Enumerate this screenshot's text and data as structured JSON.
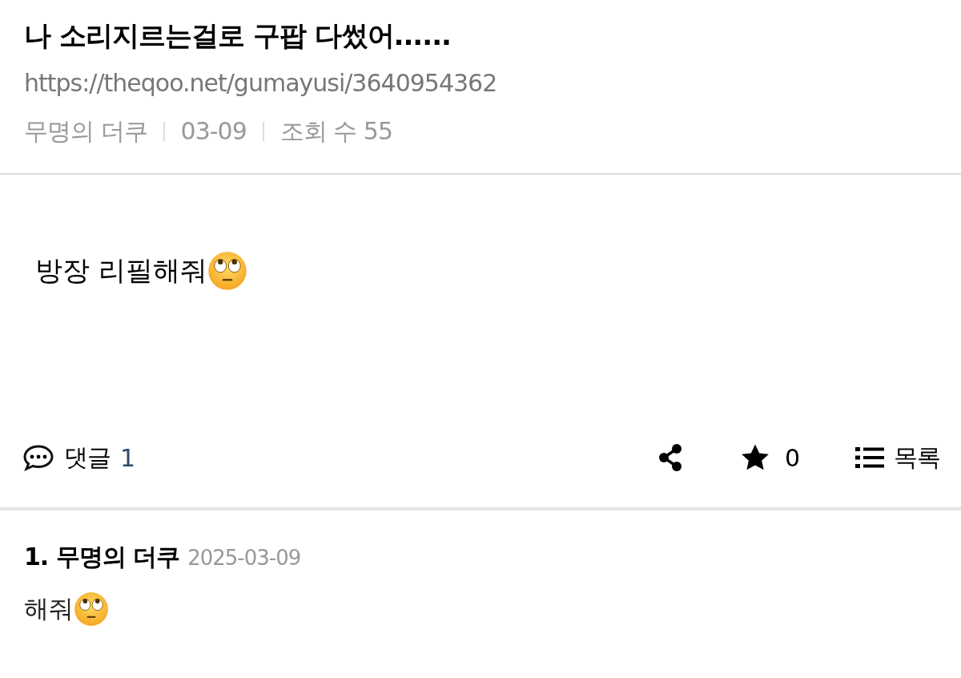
{
  "post": {
    "title": "나 소리지르는걸로 구팝 다썼어......",
    "url": "https://theqoo.net/gumayusi/3640954362",
    "meta": [
      "무명의 더쿠",
      "03-09",
      "조회 수 55"
    ],
    "body": "방장 리필해줘"
  },
  "toolbar": {
    "comments_label": "댓글",
    "comments_count": "1",
    "stars_count": "0",
    "list_label": "목록"
  },
  "comments": [
    {
      "number": "1.",
      "author": "무명의 더쿠",
      "date": "2025-03-09",
      "text": "해줘"
    }
  ]
}
